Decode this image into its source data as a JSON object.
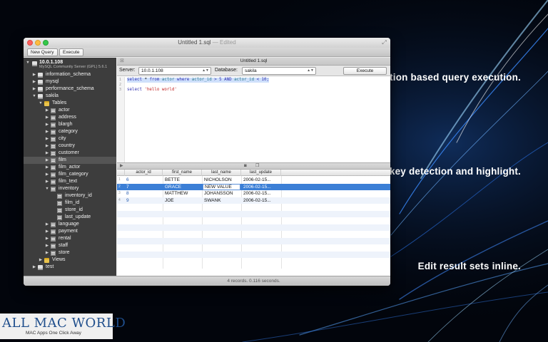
{
  "window": {
    "title": "Untitled 1.sql",
    "title_suffix": " — Edited"
  },
  "toolbar": {
    "new_query_label": "New Query",
    "execute_label": "Execute"
  },
  "sidebar": {
    "server_name": "10.0.1.108",
    "server_version": "MySQL Community Server (GPL) 5.6.1",
    "items": [
      {
        "label": "information_schema"
      },
      {
        "label": "mysql"
      },
      {
        "label": "performance_schema"
      },
      {
        "label": "sakila"
      },
      {
        "label": "Tables"
      },
      {
        "label": "actor"
      },
      {
        "label": "address"
      },
      {
        "label": "blargh"
      },
      {
        "label": "category"
      },
      {
        "label": "city"
      },
      {
        "label": "country"
      },
      {
        "label": "customer"
      },
      {
        "label": "film"
      },
      {
        "label": "film_actor"
      },
      {
        "label": "film_category"
      },
      {
        "label": "film_text"
      },
      {
        "label": "inventory"
      },
      {
        "label": "inventory_id"
      },
      {
        "label": "film_id"
      },
      {
        "label": "store_id"
      },
      {
        "label": "last_update"
      },
      {
        "label": "language"
      },
      {
        "label": "payment"
      },
      {
        "label": "rental"
      },
      {
        "label": "staff"
      },
      {
        "label": "store"
      },
      {
        "label": "Views"
      },
      {
        "label": "test"
      }
    ]
  },
  "tabbar": {
    "tab_label": "Untitled 1.sql"
  },
  "controls": {
    "server_label": "Server:",
    "server_value": "10.0.1.108",
    "database_label": "Database:",
    "database_value": "sakila",
    "execute_label": "Execute"
  },
  "editor": {
    "line_numbers": [
      "1",
      "2",
      "3"
    ],
    "line1": {
      "t1": "select",
      "t2": " * ",
      "t3": "from",
      "t4": " actor ",
      "t5": "where",
      "t6": " actor_id ",
      "t7": "> 5 ",
      "t8": "AND",
      "t9": " actor_id ",
      "t10": "< 10;"
    },
    "line3": {
      "t1": "select",
      "t2": " 'hello world'"
    }
  },
  "results": {
    "columns": [
      "actor_id",
      "first_name",
      "last_name",
      "last_update"
    ],
    "rows": [
      {
        "n": "1",
        "actor_id": "6",
        "first_name": "BETTE",
        "last_name": "NICHOLSON",
        "last_update": "2006-02-15..."
      },
      {
        "n": "2",
        "actor_id": "7",
        "first_name": "GRACE",
        "last_name": "NEW VALUE",
        "last_update": "2006-02-15..."
      },
      {
        "n": "3",
        "actor_id": "8",
        "first_name": "MATTHEW",
        "last_name": "JOHANSSON",
        "last_update": "2006-02-15..."
      },
      {
        "n": "4",
        "actor_id": "9",
        "first_name": "JOE",
        "last_name": "SWANK",
        "last_update": "2006-02-15..."
      }
    ]
  },
  "status": {
    "text": "4 records. 0.116 seconds."
  },
  "promo": {
    "line1": "Selection based query execution.",
    "line2": "Primary key detection and highlight.",
    "line3": "Edit result sets inline."
  },
  "watermark": {
    "title": "ALL MAC WORLD",
    "subtitle": "MAC Apps One Click Away"
  },
  "colors": {
    "selection": "#3b7fd6",
    "sidebar_bg": "#3d3d3d",
    "background": "#02050c"
  }
}
